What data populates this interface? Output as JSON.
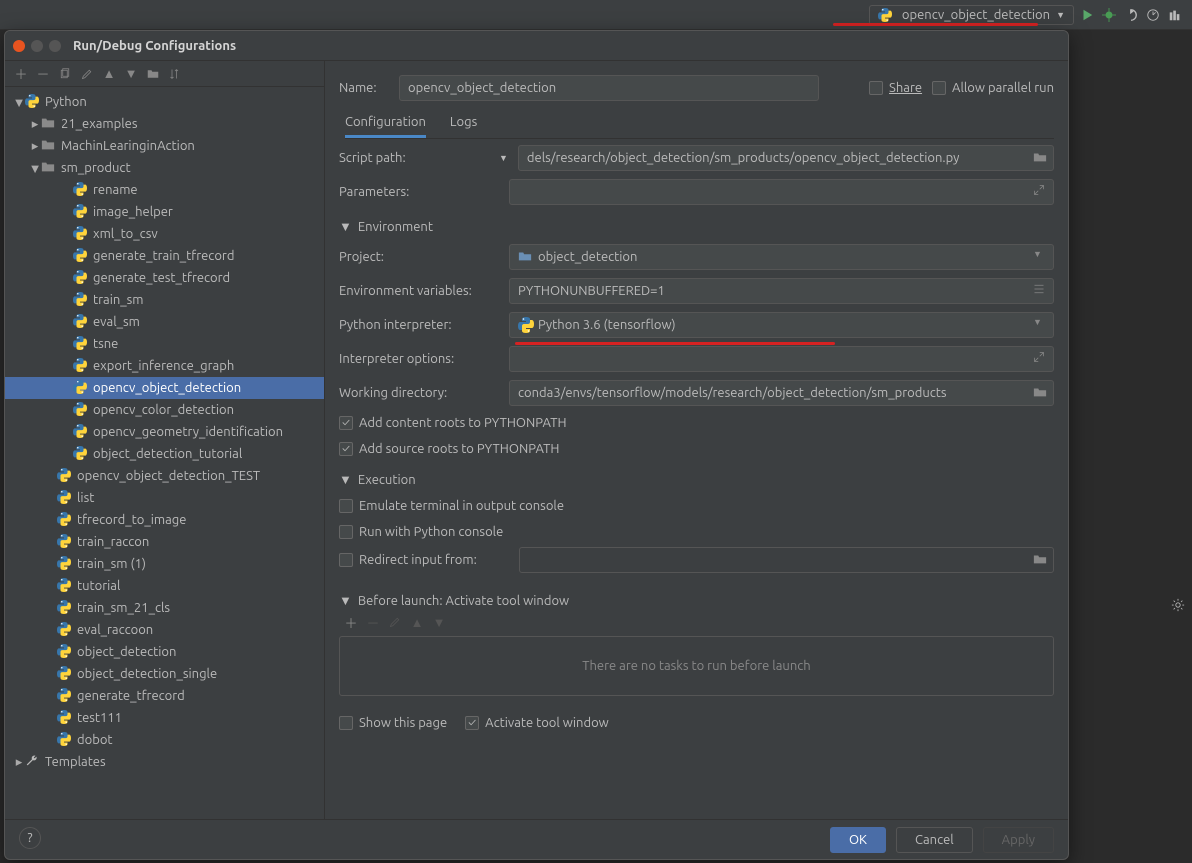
{
  "topbar": {
    "selected_config": "opencv_object_detection"
  },
  "dialog": {
    "title": "Run/Debug Configurations",
    "name_label": "Name:",
    "name_value": "opencv_object_detection",
    "share_label": "Share",
    "allow_parallel_label": "Allow parallel run",
    "tabs": {
      "config": "Configuration",
      "logs": "Logs"
    },
    "fields": {
      "script_path_label": "Script path:",
      "script_path_value": "dels/research/object_detection/sm_products/opencv_object_detection.py",
      "parameters_label": "Parameters:",
      "parameters_value": "",
      "env_header": "Environment",
      "project_label": "Project:",
      "project_value": "object_detection",
      "env_vars_label": "Environment variables:",
      "env_vars_value": "PYTHONUNBUFFERED=1",
      "interpreter_label": "Python interpreter:",
      "interpreter_value": "Python 3.6 (tensorflow)",
      "interp_options_label": "Interpreter options:",
      "interp_options_value": "",
      "working_dir_label": "Working directory:",
      "working_dir_value": "conda3/envs/tensorflow/models/research/object_detection/sm_products",
      "content_roots": "Add content roots to PYTHONPATH",
      "source_roots": "Add source roots to PYTHONPATH",
      "exec_header": "Execution",
      "emulate_terminal": "Emulate terminal in output console",
      "run_console": "Run with Python console",
      "redirect_label": "Redirect input from:",
      "redirect_value": "",
      "before_launch_header": "Before launch: Activate tool window",
      "no_tasks": "There are no tasks to run before launch",
      "show_page": "Show this page",
      "activate_window": "Activate tool window"
    },
    "buttons": {
      "ok": "OK",
      "cancel": "Cancel",
      "apply": "Apply"
    }
  },
  "tree": {
    "root": "Python",
    "templates": "Templates",
    "folders": {
      "examples": "21_examples",
      "ml_action": "MachinLearinginAction",
      "sm_product": "sm_product"
    },
    "sm_items": [
      "rename",
      "image_helper",
      "xml_to_csv",
      "generate_train_tfrecord",
      "generate_test_tfrecord",
      "train_sm",
      "eval_sm",
      "tsne",
      "export_inference_graph",
      "opencv_object_detection",
      "opencv_color_detection",
      "opencv_geometry_identification",
      "object_detection_tutorial"
    ],
    "root_items": [
      "opencv_object_detection_TEST",
      "list",
      "tfrecord_to_image",
      "train_raccon",
      "train_sm (1)",
      "tutorial",
      "train_sm_21_cls",
      "eval_raccoon",
      "object_detection",
      "object_detection_single",
      "generate_tfrecord",
      "test111",
      "dobot"
    ]
  }
}
